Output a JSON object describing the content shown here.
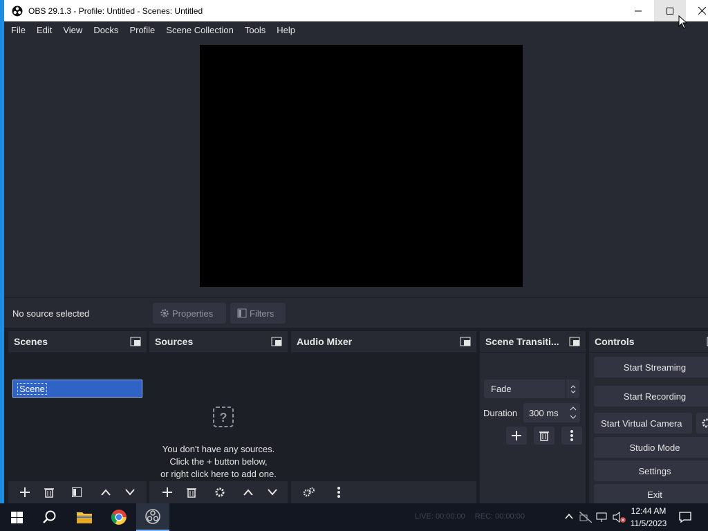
{
  "window": {
    "title": "OBS 29.1.3 - Profile: Untitled - Scenes: Untitled"
  },
  "menu": [
    "File",
    "Edit",
    "View",
    "Docks",
    "Profile",
    "Scene Collection",
    "Tools",
    "Help"
  ],
  "source_bar": {
    "status": "No source selected",
    "properties_label": "Properties",
    "filters_label": "Filters"
  },
  "docks": {
    "scenes": {
      "title": "Scenes",
      "items": [
        "Scene"
      ]
    },
    "sources": {
      "title": "Sources",
      "empty_line1": "You don't have any sources.",
      "empty_line2": "Click the + button below,",
      "empty_line3": "or right click here to add one."
    },
    "mixer": {
      "title": "Audio Mixer"
    },
    "transitions": {
      "title": "Scene Transiti...",
      "selected": "Fade",
      "duration_label": "Duration",
      "duration_value": "300 ms"
    },
    "controls": {
      "title": "Controls",
      "start_streaming": "Start Streaming",
      "start_recording": "Start Recording",
      "start_virtual_camera": "Start Virtual Camera",
      "studio_mode": "Studio Mode",
      "settings": "Settings",
      "exit": "Exit"
    }
  },
  "statusbar": {
    "live": "LIVE: 00:00:00",
    "rec": "REC: 00:00:00"
  },
  "taskbar": {
    "time": "12:44 AM",
    "date": "11/5/2023",
    "apps": [
      "windows-start",
      "search",
      "file-explorer",
      "chrome",
      "obs"
    ]
  },
  "colors": {
    "accent": "#1f8ce0",
    "selected_scene": "#2f63c5",
    "panel": "#272a33",
    "background": "#1d1f26",
    "button": "#323541"
  }
}
